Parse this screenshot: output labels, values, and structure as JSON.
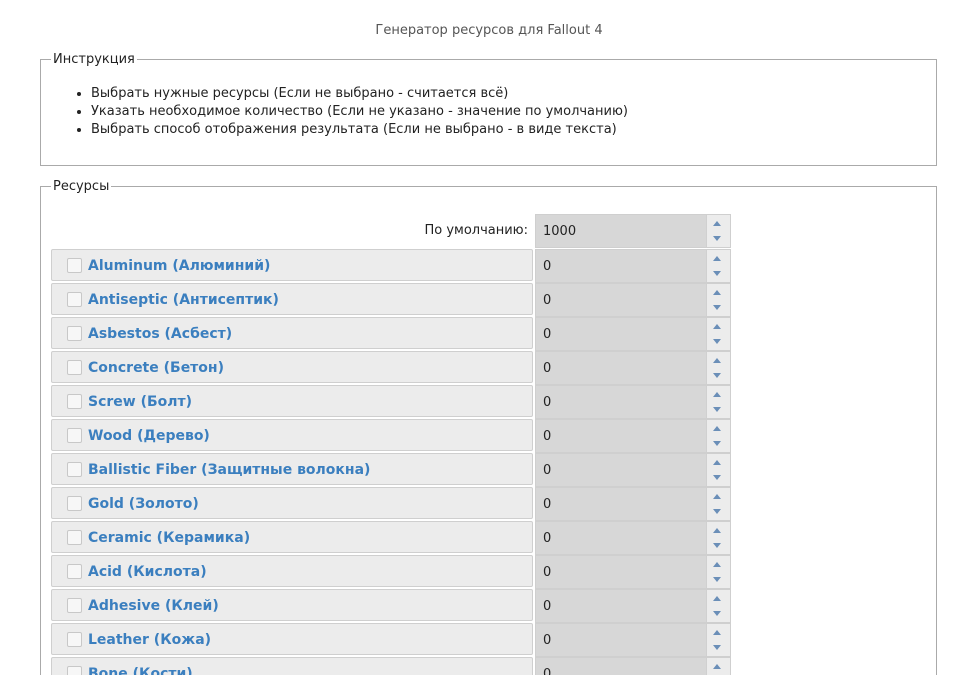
{
  "page": {
    "title": "Генератор ресурсов для Fallout 4"
  },
  "instructions": {
    "legend": "Инструкция",
    "items": [
      "Выбрать нужные ресурсы (Если не выбрано - считается всё)",
      "Указать необходимое количество (Если не указано - значение по умолчанию)",
      "Выбрать способ отображения результата (Если не выбрано - в виде текста)"
    ]
  },
  "resources": {
    "legend": "Ресурсы",
    "default_label": "По умолчанию:",
    "default_value": "1000",
    "items": [
      {
        "label": "Aluminum (Алюминий)",
        "value": "0",
        "checked": false
      },
      {
        "label": "Antiseptic (Антисептик)",
        "value": "0",
        "checked": false
      },
      {
        "label": "Asbestos (Асбест)",
        "value": "0",
        "checked": false
      },
      {
        "label": "Concrete (Бетон)",
        "value": "0",
        "checked": false
      },
      {
        "label": "Screw (Болт)",
        "value": "0",
        "checked": false
      },
      {
        "label": "Wood (Дерево)",
        "value": "0",
        "checked": false
      },
      {
        "label": "Ballistic Fiber (Защитные волокна)",
        "value": "0",
        "checked": false
      },
      {
        "label": "Gold (Золото)",
        "value": "0",
        "checked": false
      },
      {
        "label": "Ceramic (Керамика)",
        "value": "0",
        "checked": false
      },
      {
        "label": "Acid (Кислота)",
        "value": "0",
        "checked": false
      },
      {
        "label": "Adhesive (Клей)",
        "value": "0",
        "checked": false
      },
      {
        "label": "Leather (Кожа)",
        "value": "0",
        "checked": false
      },
      {
        "label": "Bone (Кости)",
        "value": "0",
        "checked": false
      }
    ]
  }
}
